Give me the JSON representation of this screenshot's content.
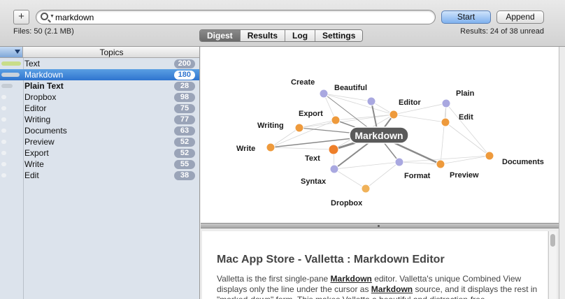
{
  "toolbar": {
    "add_label": "+",
    "search_value": "markdown",
    "start_label": "Start",
    "append_label": "Append",
    "files_info": "Files: 50 (2.1 MB)",
    "results_info": "Results: 24 of 38 unread"
  },
  "tabs": [
    {
      "label": "Digest",
      "active": true
    },
    {
      "label": "Results",
      "active": false
    },
    {
      "label": "Log",
      "active": false
    },
    {
      "label": "Settings",
      "active": false
    }
  ],
  "sidebar": {
    "header": "Topics",
    "rows": [
      {
        "label": "Text",
        "count": "200",
        "bar_color": "#c9dd8a",
        "bar_fraction": 0.95,
        "selected": false,
        "bold": false
      },
      {
        "label": "Markdown",
        "count": "180",
        "bar_color": "#c9d2dc",
        "bar_fraction": 0.9,
        "selected": true,
        "bold": false
      },
      {
        "label": "Plain Text",
        "count": "28",
        "bar_color": "#c5ccd4",
        "bar_fraction": 0.55,
        "selected": false,
        "bold": true
      },
      {
        "label": "Dropbox",
        "count": "98",
        "bar_color": "#eef1f4",
        "bar_fraction": 0.25,
        "selected": false,
        "bold": false
      },
      {
        "label": "Editor",
        "count": "75",
        "bar_color": "#eef1f4",
        "bar_fraction": 0.25,
        "selected": false,
        "bold": false
      },
      {
        "label": "Writing",
        "count": "77",
        "bar_color": "#eef1f4",
        "bar_fraction": 0.25,
        "selected": false,
        "bold": false
      },
      {
        "label": "Documents",
        "count": "63",
        "bar_color": "#eef1f4",
        "bar_fraction": 0.25,
        "selected": false,
        "bold": false
      },
      {
        "label": "Preview",
        "count": "52",
        "bar_color": "#eef1f4",
        "bar_fraction": 0.25,
        "selected": false,
        "bold": false
      },
      {
        "label": "Export",
        "count": "52",
        "bar_color": "#eef1f4",
        "bar_fraction": 0.25,
        "selected": false,
        "bold": false
      },
      {
        "label": "Write",
        "count": "55",
        "bar_color": "#eef1f4",
        "bar_fraction": 0.25,
        "selected": false,
        "bold": false
      },
      {
        "label": "Edit",
        "count": "38",
        "bar_color": "#eef1f4",
        "bar_fraction": 0.25,
        "selected": false,
        "bold": false
      }
    ]
  },
  "graph": {
    "center_label": "Markdown",
    "nodes": [
      {
        "label": "Create",
        "color": "#a9a8e0"
      },
      {
        "label": "Beautiful",
        "color": "#a9a8e0"
      },
      {
        "label": "Editor",
        "color": "#ee9a3c"
      },
      {
        "label": "Plain",
        "color": "#a9a8e0"
      },
      {
        "label": "Export",
        "color": "#ee9a3c"
      },
      {
        "label": "Edit",
        "color": "#ee9a3c"
      },
      {
        "label": "Writing",
        "color": "#ee9a3c"
      },
      {
        "label": "Write",
        "color": "#ee9a3c"
      },
      {
        "label": "Text",
        "color": "#ee7f2a"
      },
      {
        "label": "Documents",
        "color": "#ee9a3c"
      },
      {
        "label": "Syntax",
        "color": "#a9a8e0"
      },
      {
        "label": "Format",
        "color": "#a9a8e0"
      },
      {
        "label": "Preview",
        "color": "#ee9a3c"
      },
      {
        "label": "Dropbox",
        "color": "#f0b25a"
      }
    ]
  },
  "article": {
    "title": "Mac App Store - Valletta : Markdown Editor",
    "body": [
      {
        "text": "Valletta is the first single-pane ",
        "em": false
      },
      {
        "text": "Markdown",
        "em": true
      },
      {
        "text": " editor. Valletta's unique Combined View displays only the line under the cursor as ",
        "em": false
      },
      {
        "text": "Markdown",
        "em": true
      },
      {
        "text": " source, and it displays the rest in \"marked-down\" form. This makes Valletta a beautiful and distraction-free",
        "em": false
      }
    ]
  }
}
